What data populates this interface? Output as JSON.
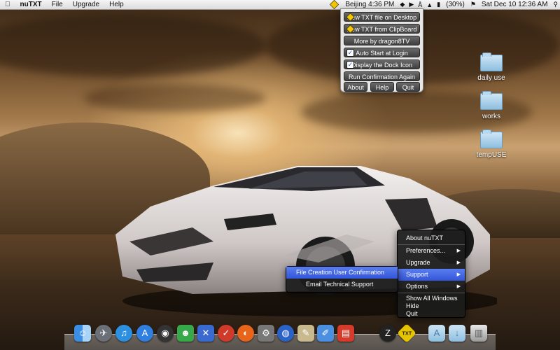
{
  "menubar": {
    "apple": "",
    "app_name": "nuTXT",
    "menus": [
      "File",
      "Upgrade",
      "Help"
    ],
    "status_city": "Beijing 4:36 PM",
    "battery": "(30%)",
    "clock": "Sat Dec 10  12:36 AM"
  },
  "panel": {
    "buttons": [
      {
        "label": "New TXT file on Desktop",
        "icon": "diamond-icon"
      },
      {
        "label": "New TXT from ClipBoard",
        "icon": "diamond-icon"
      },
      {
        "label": "More by dragon8TV",
        "icon": ""
      },
      {
        "label": "Auto Start at Login",
        "icon": "checkbox-checked-icon"
      },
      {
        "label": "Display the Dock Icon",
        "icon": "checkbox-checked-icon"
      },
      {
        "label": "Run Confirmation Again",
        "icon": ""
      }
    ],
    "bottom": [
      "About",
      "Help",
      "Quit"
    ]
  },
  "desktop_folders": [
    "daily use",
    "works",
    "tempUSE"
  ],
  "dock_menu": {
    "items": [
      {
        "label": "About  nuTXT",
        "submenu": false
      },
      {
        "label": "Preferences...",
        "submenu": true
      },
      {
        "label": "Upgrade",
        "submenu": true
      },
      {
        "label": "Support",
        "submenu": true
      },
      {
        "label": "Options",
        "submenu": true
      }
    ],
    "bottom": [
      "Show All Windows",
      "Hide",
      "Quit"
    ]
  },
  "support_submenu": [
    "File Creation User Confirmation",
    "Email Technical Support"
  ],
  "dock": {
    "icons": [
      "finder-icon",
      "rocket-icon",
      "itunes-icon",
      "appstore-icon",
      "dashboard-icon",
      "messenger-icon",
      "xcode-icon",
      "toolbox-icon",
      "firefox-icon",
      "system-prefs-icon",
      "chrome-icon",
      "preview-icon",
      "textedit-icon",
      "pdf-icon",
      "zip-icon",
      "nutxt-icon",
      "apps-folder-icon",
      "downloads-folder-icon",
      "trash-icon"
    ]
  },
  "colors": {
    "highlight": "#3a5fe0",
    "panel_button": "#4a4a4a"
  }
}
